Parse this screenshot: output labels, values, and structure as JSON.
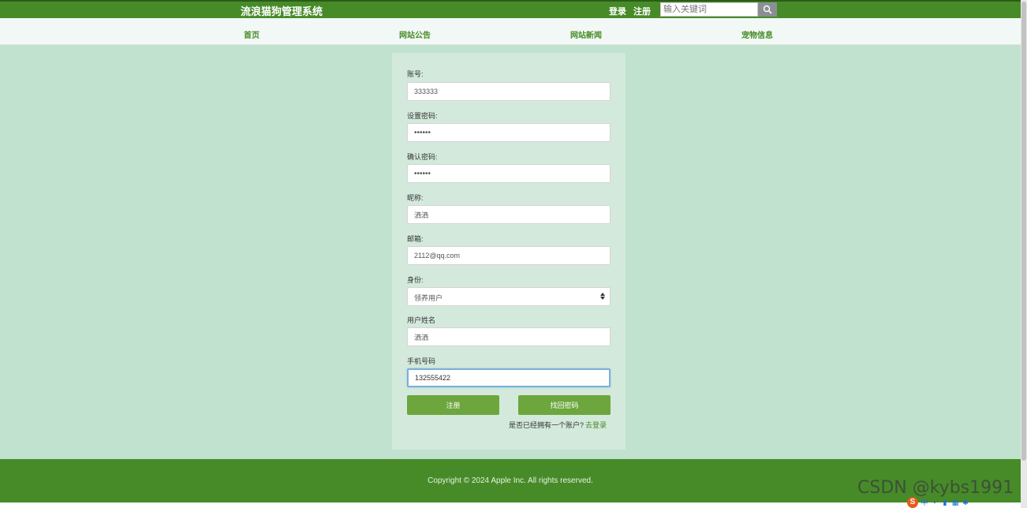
{
  "header": {
    "brand": "流浪猫狗管理系统",
    "login_label": "登录",
    "register_label": "注册",
    "search_placeholder": "输入关键词"
  },
  "nav": {
    "items": [
      {
        "label": "首页"
      },
      {
        "label": "网站公告"
      },
      {
        "label": "网站新闻"
      },
      {
        "label": "宠物信息"
      }
    ]
  },
  "form": {
    "account": {
      "label": "账号:",
      "value": "333333"
    },
    "password": {
      "label": "设置密码:",
      "value": "••••••"
    },
    "confirm": {
      "label": "确认密码:",
      "value": "••••••"
    },
    "nickname": {
      "label": "昵称:",
      "value": "洒洒"
    },
    "email": {
      "label": "邮箱:",
      "value": "2112@qq.com"
    },
    "identity": {
      "label": "身份:",
      "value": "领养用户"
    },
    "realname": {
      "label": "用户姓名",
      "value": "洒洒"
    },
    "phone": {
      "label": "手机号码",
      "value": "132555422"
    },
    "register_button": "注册",
    "recover_button": "找回密码",
    "has_account_text": "是否已经拥有一个账户?",
    "go_login_link": "去登录"
  },
  "footer": {
    "copyright": "Copyright © 2024 Apple Inc. All rights reserved."
  },
  "watermark": "CSDN @kybs1991",
  "tray": {
    "ime_label": "中",
    "sogou_label": "S"
  },
  "colors": {
    "primary": "#468b28",
    "button": "#6ca63d",
    "page_bg": "#c0e2ce",
    "card_bg": "#d3e9dc"
  }
}
